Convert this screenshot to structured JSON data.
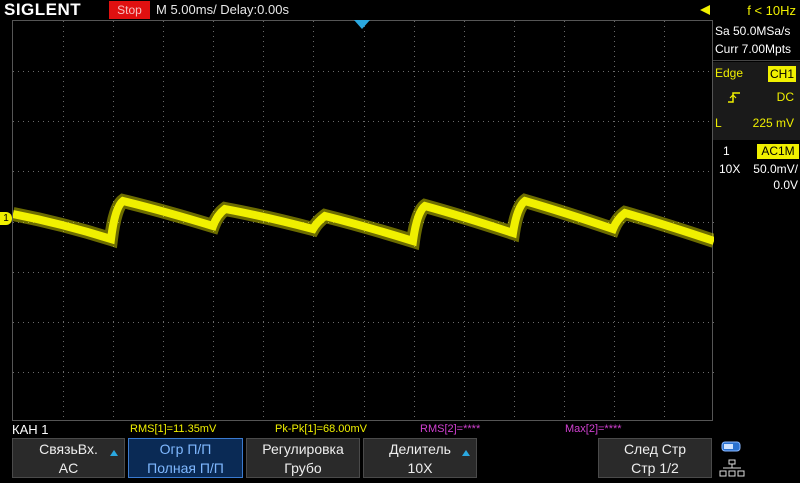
{
  "header": {
    "brand": "SIGLENT",
    "run_state": "Stop",
    "timebase": "M 5.00ms/ Delay:0.00s",
    "trigger_freq": "f < 10Hz"
  },
  "right_panel": {
    "sample_rate": "Sa 50.0MSa/s",
    "memory": "Curr 7.00Mpts",
    "trigger": {
      "type": "Edge",
      "source": "CH1",
      "coupling": "DC",
      "level_label": "L",
      "level_value": "225 mV"
    },
    "channel": {
      "number": "1",
      "coupling": "AC1M",
      "probe": "10X",
      "scale": "50.0mV/",
      "offset": "0.0V"
    }
  },
  "measurements": {
    "channel_label": "КАН 1",
    "m1": "RMS[1]=11.35mV",
    "m2": "Pk-Pk[1]=68.00mV",
    "m3": "RMS[2]=****",
    "m4": "Max[2]=****"
  },
  "softkeys": [
    {
      "line1": "СвязьВх.",
      "line2": "AC"
    },
    {
      "line1": "Огр П/П",
      "line2": "Полная П/П"
    },
    {
      "line1": "Регулировка",
      "line2": "Грубо"
    },
    {
      "line1": "Делитель",
      "line2": "10X"
    },
    {
      "line1": "След Стр",
      "line2": "Стр 1/2"
    }
  ],
  "channel_marker": "1",
  "colors": {
    "trace": "#f0f000",
    "grid": "#6a6a6a",
    "accent": "#3a7ad0",
    "measure_ch1": "#f0f000",
    "measure_ch2": "#d040d0"
  }
}
